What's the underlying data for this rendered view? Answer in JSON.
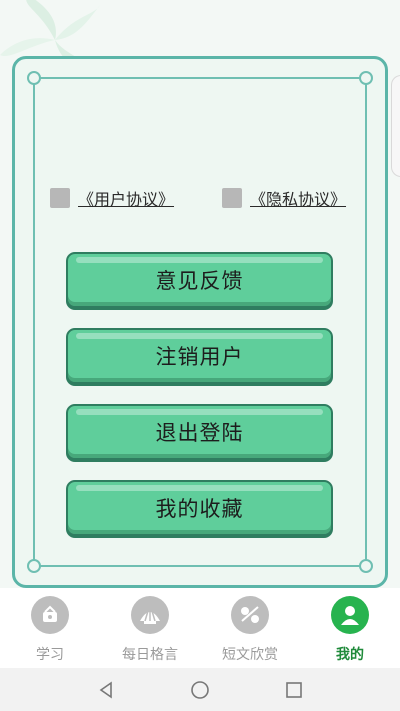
{
  "agreements": [
    {
      "label": "《用户协议》"
    },
    {
      "label": "《隐私协议》"
    }
  ],
  "menu": [
    {
      "label": "意见反馈"
    },
    {
      "label": "注销用户"
    },
    {
      "label": "退出登陆"
    },
    {
      "label": "我的收藏"
    }
  ],
  "tabs": [
    {
      "label": "学习",
      "icon": "study-icon"
    },
    {
      "label": "每日格言",
      "icon": "daily-quote-icon"
    },
    {
      "label": "短文欣赏",
      "icon": "essay-icon"
    },
    {
      "label": "我的",
      "icon": "profile-icon",
      "active": true
    }
  ],
  "colors": {
    "accent": "#5fce9b",
    "frame": "#5bb5a8",
    "active_tab": "#1f8a3a",
    "inactive_tab": "#9a9a9a"
  }
}
